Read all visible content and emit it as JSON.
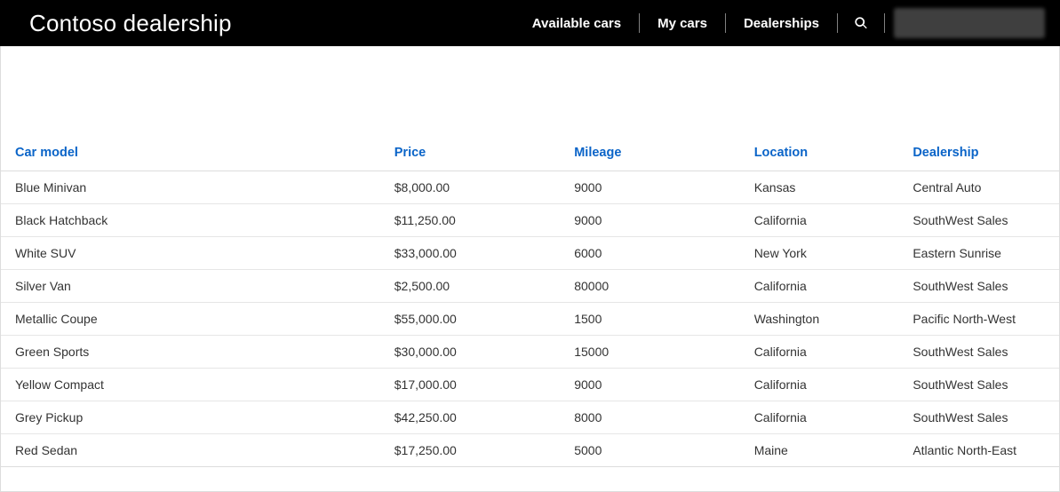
{
  "header": {
    "title": "Contoso dealership",
    "nav": [
      {
        "label": "Available cars"
      },
      {
        "label": "My cars"
      },
      {
        "label": "Dealerships"
      }
    ]
  },
  "table": {
    "columns": [
      {
        "label": "Car model"
      },
      {
        "label": "Price"
      },
      {
        "label": "Mileage"
      },
      {
        "label": "Location"
      },
      {
        "label": "Dealership"
      }
    ],
    "rows": [
      {
        "model": "Blue Minivan",
        "price": "$8,000.00",
        "mileage": "9000",
        "location": "Kansas",
        "dealership": "Central Auto"
      },
      {
        "model": "Black Hatchback",
        "price": "$11,250.00",
        "mileage": "9000",
        "location": "California",
        "dealership": "SouthWest Sales"
      },
      {
        "model": "White SUV",
        "price": "$33,000.00",
        "mileage": "6000",
        "location": "New York",
        "dealership": "Eastern Sunrise"
      },
      {
        "model": "Silver Van",
        "price": "$2,500.00",
        "mileage": "80000",
        "location": "California",
        "dealership": "SouthWest Sales"
      },
      {
        "model": "Metallic Coupe",
        "price": "$55,000.00",
        "mileage": "1500",
        "location": "Washington",
        "dealership": "Pacific North-West"
      },
      {
        "model": "Green Sports",
        "price": "$30,000.00",
        "mileage": "15000",
        "location": "California",
        "dealership": "SouthWest Sales"
      },
      {
        "model": "Yellow Compact",
        "price": "$17,000.00",
        "mileage": "9000",
        "location": "California",
        "dealership": "SouthWest Sales"
      },
      {
        "model": "Grey Pickup",
        "price": "$42,250.00",
        "mileage": "8000",
        "location": "California",
        "dealership": "SouthWest Sales"
      },
      {
        "model": "Red Sedan",
        "price": "$17,250.00",
        "mileage": "5000",
        "location": "Maine",
        "dealership": "Atlantic North-East"
      }
    ]
  }
}
